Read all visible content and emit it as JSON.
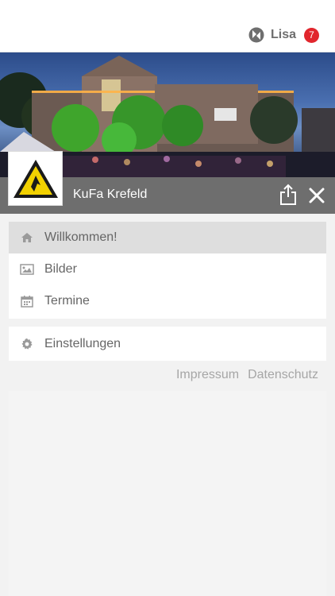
{
  "header": {
    "user": {
      "logo_icon": "kufa-app-logo-icon",
      "name": "Lisa",
      "badge": "7"
    }
  },
  "hero": {
    "image": "kufa-building-night-photo",
    "logo": "kufa-krefeld-logo"
  },
  "titlebar": {
    "title": "KuFa Krefeld",
    "share_icon": "share-icon",
    "close_icon": "close-icon"
  },
  "menu": {
    "items": [
      {
        "label": "Willkommen!",
        "icon": "home-icon",
        "active": true
      },
      {
        "label": "Bilder",
        "icon": "image-icon",
        "active": false
      },
      {
        "label": "Termine",
        "icon": "calendar-icon",
        "active": false
      }
    ],
    "settings": {
      "label": "Einstellungen",
      "icon": "gear-icon"
    }
  },
  "footer": {
    "impressum": "Impressum",
    "datenschutz": "Datenschutz"
  },
  "colors": {
    "badge": "#e1262d",
    "titlebar": "#6e6e6e",
    "active_item": "#dedede"
  }
}
